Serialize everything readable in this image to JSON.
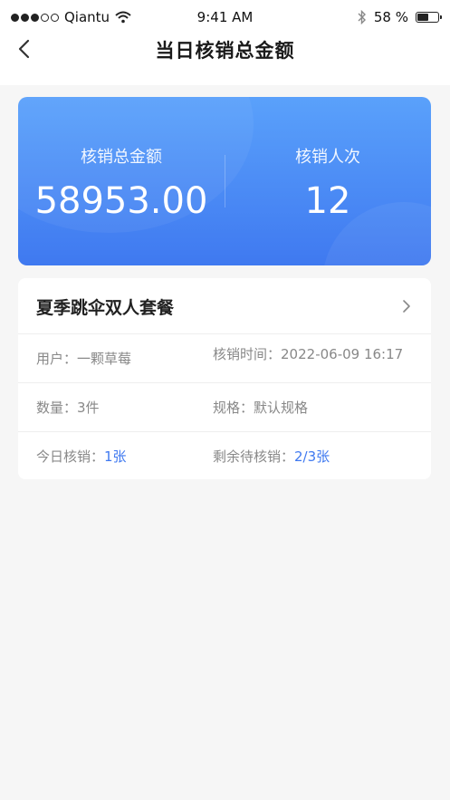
{
  "status_bar": {
    "carrier": "Qiantu",
    "time": "9:41 AM",
    "battery": "58 %",
    "battery_level": 0.58
  },
  "nav": {
    "title": "当日核销总金额"
  },
  "summary": {
    "total_label": "核销总金额",
    "total_value": "58953.00",
    "count_label": "核销人次",
    "count_value": "12"
  },
  "order": {
    "product_name": "夏季跳伞双人套餐",
    "user_label": "用户：",
    "user_value": "一颗草莓",
    "time_label": "核销时间：",
    "time_value": "2022-06-09 16:17",
    "qty_label": "数量：",
    "qty_value": "3件",
    "spec_label": "规格：",
    "spec_value": "默认规格",
    "today_label": "今日核销：",
    "today_value": "1张",
    "remain_label": "剩余待核销：",
    "remain_value": "2/3张"
  },
  "colors": {
    "accent": "#3f79f0",
    "card_gradient_top": "#5aa1fb",
    "card_gradient_bottom": "#3f79f0"
  }
}
